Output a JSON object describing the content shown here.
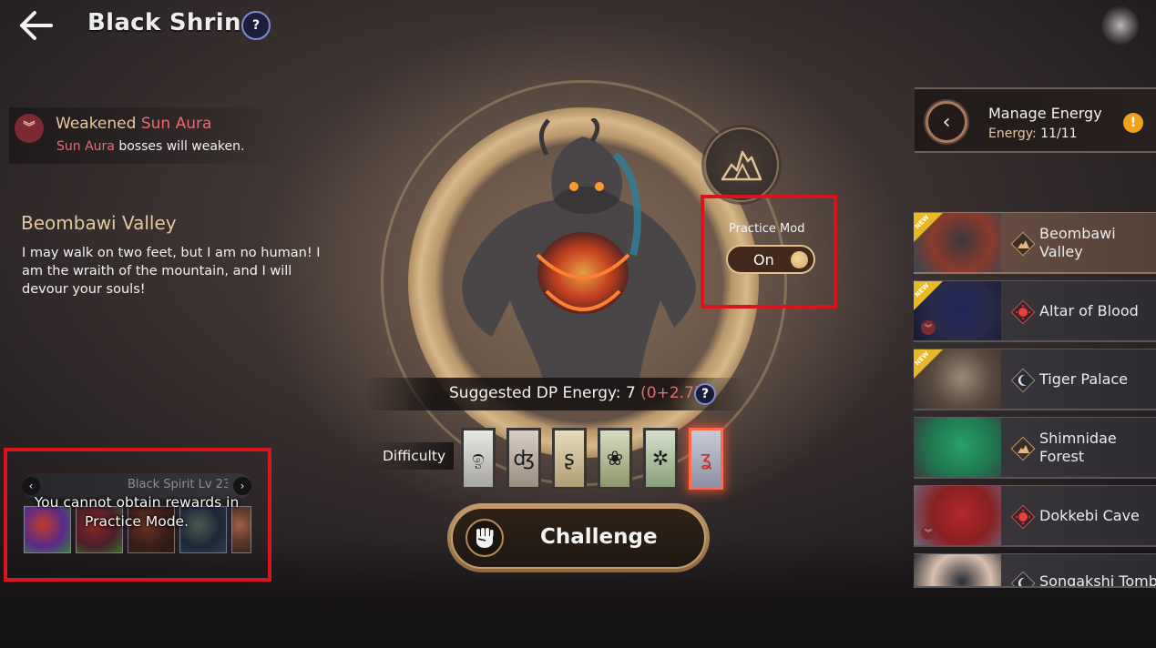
{
  "header": {
    "title": "Black Shrine",
    "back_icon": "arrow-left-icon",
    "help_icon": "help-book-icon"
  },
  "buff": {
    "icon": "weaken-chevrons-icon",
    "title_prefix": "Weakened ",
    "title_highlight": "Sun Aura",
    "desc_highlight": "Sun Aura",
    "desc_suffix": " bosses will weaken."
  },
  "boss": {
    "name": "Beombawi Valley",
    "quote": "I may walk on two feet, but I am no human! I am the wraith of the mountain, and I will devour your souls!",
    "element_icon": "mountain-icon"
  },
  "practice_mode": {
    "label": "Practice Mod",
    "toggle_label": "On",
    "enabled": true
  },
  "suggested": {
    "label": "Suggested DP Energy: 7 ",
    "bonus": "(0+2.7)",
    "help_icon": "question-icon"
  },
  "difficulty": {
    "label": "Difficulty",
    "levels": [
      {
        "glyph": "ඉ",
        "colors": [
          "#e8e8e6",
          "#a7a5a2"
        ]
      },
      {
        "glyph": "ʤ",
        "colors": [
          "#d9cfc6",
          "#9b8c80"
        ]
      },
      {
        "glyph": "ʂ",
        "colors": [
          "#e9dcbc",
          "#b19d72"
        ]
      },
      {
        "glyph": "❀",
        "colors": [
          "#d8dcc0",
          "#8e976a"
        ]
      },
      {
        "glyph": "✲",
        "colors": [
          "#d6e0cc",
          "#88a078"
        ]
      },
      {
        "glyph": "ʓ",
        "colors": [
          "#c8ccd8",
          "#8c90a4"
        ]
      }
    ],
    "selected_index": 5
  },
  "challenge": {
    "label": "Challenge",
    "icon": "fist-icon"
  },
  "rewards": {
    "bar_label": "Black Spirit Lv 23",
    "warning": "You cannot obtain rewards in Practice Mode.",
    "prev_icon": "chevron-left-icon",
    "next_icon": "chevron-right-icon",
    "slots": [
      {
        "colors": [
          "#5a2b8a",
          "#c03a2a",
          "#3a7a3a"
        ]
      },
      {
        "colors": [
          "#4a1e2a",
          "#8a2a22",
          "#3a6a2a"
        ]
      },
      {
        "colors": [
          "#3a1e18",
          "#6a3220",
          "#2a1a14"
        ]
      },
      {
        "colors": [
          "#1e2838",
          "#4a5a50",
          "#2a3a48"
        ]
      },
      {
        "colors": [
          "#5a3a2a",
          "#a06048",
          "#3a2820"
        ]
      }
    ]
  },
  "energy": {
    "title": "Manage Energy",
    "label": "Energy: ",
    "value": "11/11",
    "back_icon": "chevron-left-icon",
    "alert_icon": "exclamation-icon"
  },
  "dungeons": [
    {
      "name": "Beombawi Valley",
      "aura": "mountain",
      "is_new": true,
      "weakened": false,
      "active": true,
      "portrait": [
        "#3a3a3e",
        "#8a3a2a",
        "#2a4a5a"
      ]
    },
    {
      "name": "Altar of Blood",
      "aura": "sun",
      "is_new": true,
      "weakened": true,
      "active": false,
      "portrait": [
        "#1e2a5a",
        "#2a2a4a",
        "#141830"
      ]
    },
    {
      "name": "Tiger Palace",
      "aura": "moon",
      "is_new": true,
      "weakened": false,
      "active": false,
      "portrait": [
        "#9a8a78",
        "#5a4a3e",
        "#3a3030"
      ]
    },
    {
      "name": "Shimnidae Forest",
      "aura": "mountain",
      "is_new": false,
      "weakened": false,
      "active": false,
      "portrait": [
        "#2aa06a",
        "#1f7a50",
        "#3a3a3e"
      ]
    },
    {
      "name": "Dokkebi Cave",
      "aura": "sun",
      "is_new": false,
      "weakened": true,
      "active": false,
      "portrait": [
        "#b02a2a",
        "#8a2020",
        "#6a6a80"
      ]
    },
    {
      "name": "Songakshi Tomb",
      "aura": "moon",
      "is_new": false,
      "weakened": false,
      "active": false,
      "portrait": [
        "#2a2a30",
        "#d8c0b0",
        "#1a1a1e"
      ]
    }
  ],
  "badges": {
    "new": "NEW"
  },
  "colors": {
    "highlight_red": "#d8141c",
    "aura_red": "#ea6a6e",
    "gold": "#e4c79c",
    "alert": "#f4a21a"
  }
}
